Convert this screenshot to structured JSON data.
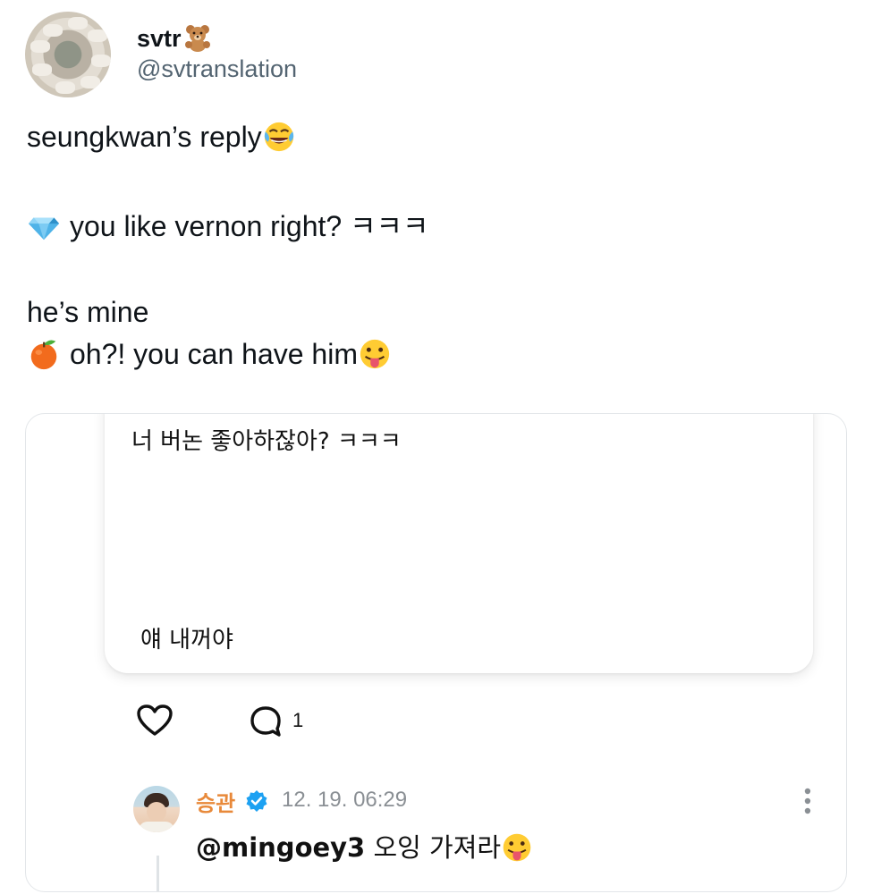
{
  "header": {
    "display_name": "svtr",
    "handle": "@svtranslation",
    "name_emoji": "teddy-bear"
  },
  "tweet": {
    "line1": "seungkwan’s reply",
    "line1_emoji": "face-with-tears-of-joy",
    "line2_emoji": "gem-stone",
    "line2": "you like vernon right? ㅋㅋㅋ",
    "line3": "he’s mine",
    "line4_emoji": "tangerine",
    "line4": "oh?! you can have him",
    "line4_end_emoji": "face-with-tongue"
  },
  "embedded": {
    "bubble_line1": "너 버논 좋아하잖아? ㅋㅋㅋ",
    "bubble_line2": "얘 내꺼야",
    "comment_count": "1",
    "reply": {
      "name": "승관",
      "time": "12. 19. 06:29",
      "mention": "@mingoey3",
      "text": "오잉 가져라",
      "end_emoji": "face-with-tongue"
    }
  },
  "colors": {
    "reply_name": "#e8893a",
    "verified": "#1da1f2",
    "handle": "#536471"
  }
}
